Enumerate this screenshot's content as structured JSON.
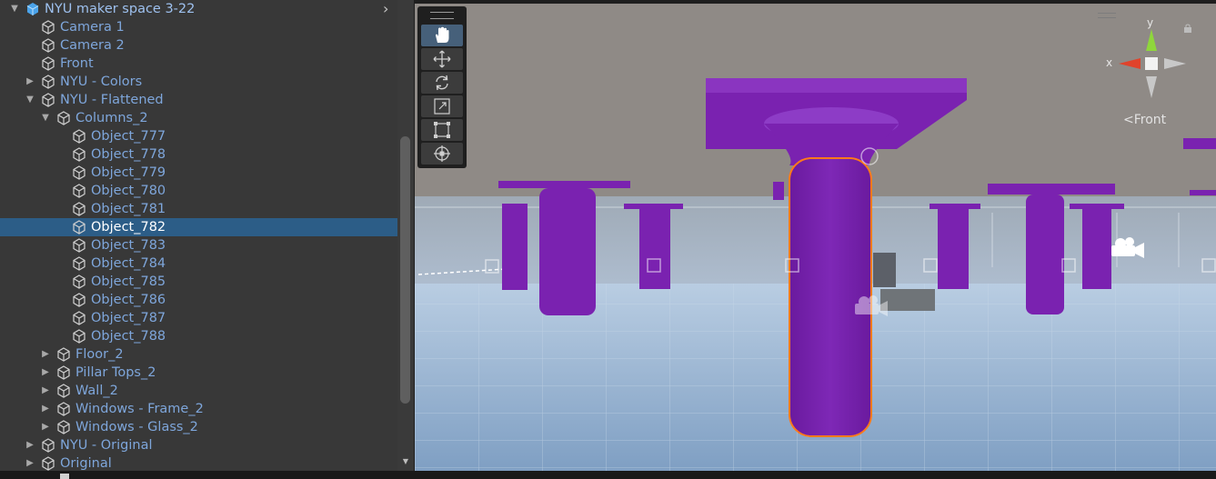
{
  "hierarchy": {
    "rows": [
      {
        "label": "NYU maker space 3-22",
        "indent": 0,
        "arrow": "down",
        "icon": "prefab-icon",
        "root": true
      },
      {
        "label": "Camera 1",
        "indent": 1,
        "arrow": "",
        "icon": "gameobject-icon"
      },
      {
        "label": "Camera 2",
        "indent": 1,
        "arrow": "",
        "icon": "gameobject-icon"
      },
      {
        "label": "Front",
        "indent": 1,
        "arrow": "",
        "icon": "gameobject-icon"
      },
      {
        "label": "NYU - Colors",
        "indent": 1,
        "arrow": "right",
        "icon": "gameobject-icon"
      },
      {
        "label": "NYU - Flattened",
        "indent": 1,
        "arrow": "down",
        "icon": "gameobject-icon"
      },
      {
        "label": "Columns_2",
        "indent": 2,
        "arrow": "down",
        "icon": "gameobject-icon"
      },
      {
        "label": "Object_777",
        "indent": 3,
        "arrow": "",
        "icon": "gameobject-icon"
      },
      {
        "label": "Object_778",
        "indent": 3,
        "arrow": "",
        "icon": "gameobject-icon"
      },
      {
        "label": "Object_779",
        "indent": 3,
        "arrow": "",
        "icon": "gameobject-icon"
      },
      {
        "label": "Object_780",
        "indent": 3,
        "arrow": "",
        "icon": "gameobject-icon"
      },
      {
        "label": "Object_781",
        "indent": 3,
        "arrow": "",
        "icon": "gameobject-icon"
      },
      {
        "label": "Object_782",
        "indent": 3,
        "arrow": "",
        "icon": "gameobject-icon",
        "selected": true
      },
      {
        "label": "Object_783",
        "indent": 3,
        "arrow": "",
        "icon": "gameobject-icon"
      },
      {
        "label": "Object_784",
        "indent": 3,
        "arrow": "",
        "icon": "gameobject-icon"
      },
      {
        "label": "Object_785",
        "indent": 3,
        "arrow": "",
        "icon": "gameobject-icon"
      },
      {
        "label": "Object_786",
        "indent": 3,
        "arrow": "",
        "icon": "gameobject-icon"
      },
      {
        "label": "Object_787",
        "indent": 3,
        "arrow": "",
        "icon": "gameobject-icon"
      },
      {
        "label": "Object_788",
        "indent": 3,
        "arrow": "",
        "icon": "gameobject-icon"
      },
      {
        "label": "Floor_2",
        "indent": 2,
        "arrow": "right",
        "icon": "gameobject-icon"
      },
      {
        "label": "Pillar Tops_2",
        "indent": 2,
        "arrow": "right",
        "icon": "gameobject-icon"
      },
      {
        "label": "Wall_2",
        "indent": 2,
        "arrow": "right",
        "icon": "gameobject-icon"
      },
      {
        "label": "Windows - Frame_2",
        "indent": 2,
        "arrow": "right",
        "icon": "gameobject-icon"
      },
      {
        "label": "Windows - Glass_2",
        "indent": 2,
        "arrow": "right",
        "icon": "gameobject-icon"
      },
      {
        "label": "NYU - Original",
        "indent": 1,
        "arrow": "right",
        "icon": "gameobject-icon"
      },
      {
        "label": "Original",
        "indent": 1,
        "arrow": "right",
        "icon": "gameobject-icon"
      }
    ]
  },
  "toolbar": {
    "tools": [
      {
        "name": "hand-tool",
        "icon": "hand-icon",
        "active": true
      },
      {
        "name": "move-tool",
        "icon": "move-icon"
      },
      {
        "name": "rotate-tool",
        "icon": "rotate-icon"
      },
      {
        "name": "scale-tool",
        "icon": "scale-icon"
      },
      {
        "name": "rect-tool",
        "icon": "rect-transform-icon"
      },
      {
        "name": "transform-tool",
        "icon": "transform-icon"
      }
    ]
  },
  "gizmo": {
    "y_label": "y",
    "x_label": "x",
    "view_label": "Front"
  },
  "colors": {
    "selection": "#2c5d87",
    "pillar": "#7a22b0",
    "outline": "#ff7a1a",
    "floor": "#a9c3dd"
  }
}
